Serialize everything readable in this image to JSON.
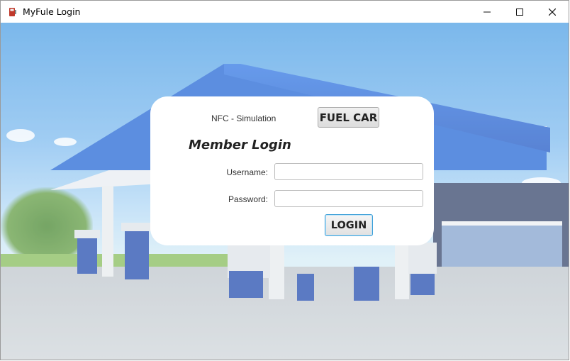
{
  "window": {
    "title": "MyFule Login",
    "icon": "fuel-pump-icon",
    "controls": {
      "minimize": "—",
      "maximize": "☐",
      "close": "✕"
    }
  },
  "card": {
    "nfc_label": "NFC - Simulation",
    "fuel_button": "FUEL CAR",
    "heading": "Member Login",
    "username_label": "Username:",
    "username_value": "",
    "password_label": "Password:",
    "password_value": "",
    "login_button": "LOGIN"
  },
  "colors": {
    "login_focus_border": "#3c9fd8",
    "canopy_blue": "#2f6fd8",
    "sky_blue": "#56a4e6"
  }
}
